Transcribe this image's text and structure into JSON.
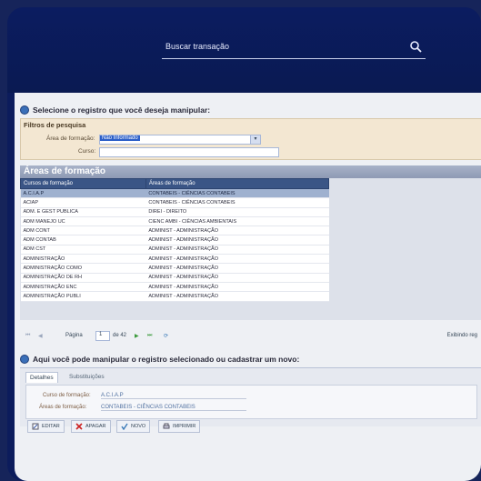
{
  "search": {
    "placeholder": "Buscar transação"
  },
  "section1": {
    "title": "Selecione o registro que você deseja manipular:"
  },
  "filters": {
    "title": "Filtros de pesquisa",
    "area_label": "Área de formação:",
    "area_value": "Não Informado",
    "curso_label": "Curso:",
    "curso_value": ""
  },
  "grid": {
    "title": "Áreas de formação",
    "columns": [
      "Cursos de formação",
      "Áreas de formação"
    ],
    "rows": [
      [
        "A.C.I.A.P",
        "CONTABEIS - CIÊNCIAS CONTABEIS"
      ],
      [
        "ACIAP",
        "CONTABEIS - CIÊNCIAS CONTABEIS"
      ],
      [
        "ADM. E GEST PUBLICA",
        "DIREI - DIREITO"
      ],
      [
        "ADM MANEJO UC",
        "CIENC AMBI - CIÊNCIAS AMBIENTAIS"
      ],
      [
        "ADM CONT",
        "ADMINIST - ADMINISTRAÇÃO"
      ],
      [
        "ADM CONTAB",
        "ADMINIST - ADMINISTRAÇÃO"
      ],
      [
        "ADM CST",
        "ADMINIST - ADMINISTRAÇÃO"
      ],
      [
        "ADMINISTRAÇÃO",
        "ADMINIST - ADMINISTRAÇÃO"
      ],
      [
        "ADMINISTRAÇÃO COMO",
        "ADMINIST - ADMINISTRAÇÃO"
      ],
      [
        "ADMINISTRAÇÃO DE RH",
        "ADMINIST - ADMINISTRAÇÃO"
      ],
      [
        "ADMINISTRAÇÃO ENC",
        "ADMINIST - ADMINISTRAÇÃO"
      ],
      [
        "ADMINISTRAÇÃO PUBLI",
        "ADMINIST - ADMINISTRAÇÃO"
      ]
    ],
    "selected_row": 0
  },
  "pager": {
    "page_label": "Página",
    "page_value": "1",
    "of_label": "de 42",
    "status": "Exibindo reg"
  },
  "section2": {
    "title": "Aqui você pode manipular o registro selecionado ou cadastrar um novo:"
  },
  "tabs": [
    {
      "label": "Detalhes"
    },
    {
      "label": "Substituições"
    }
  ],
  "details": {
    "curso_label": "Curso de formação:",
    "curso_value": "A.C.I.A.P",
    "area_label": "Áreas de formação:",
    "area_value": "CONTABEIS - CIÊNCIAS CONTABEIS"
  },
  "buttons": {
    "edit": "EDITAR",
    "delete": "APAGAR",
    "new": "NOVO",
    "print": "IMPRIMIR"
  },
  "colors": {
    "header_bg": "#0c1c5c",
    "grid_header": "#3a5586",
    "selected_row": "#9fb1cf"
  }
}
